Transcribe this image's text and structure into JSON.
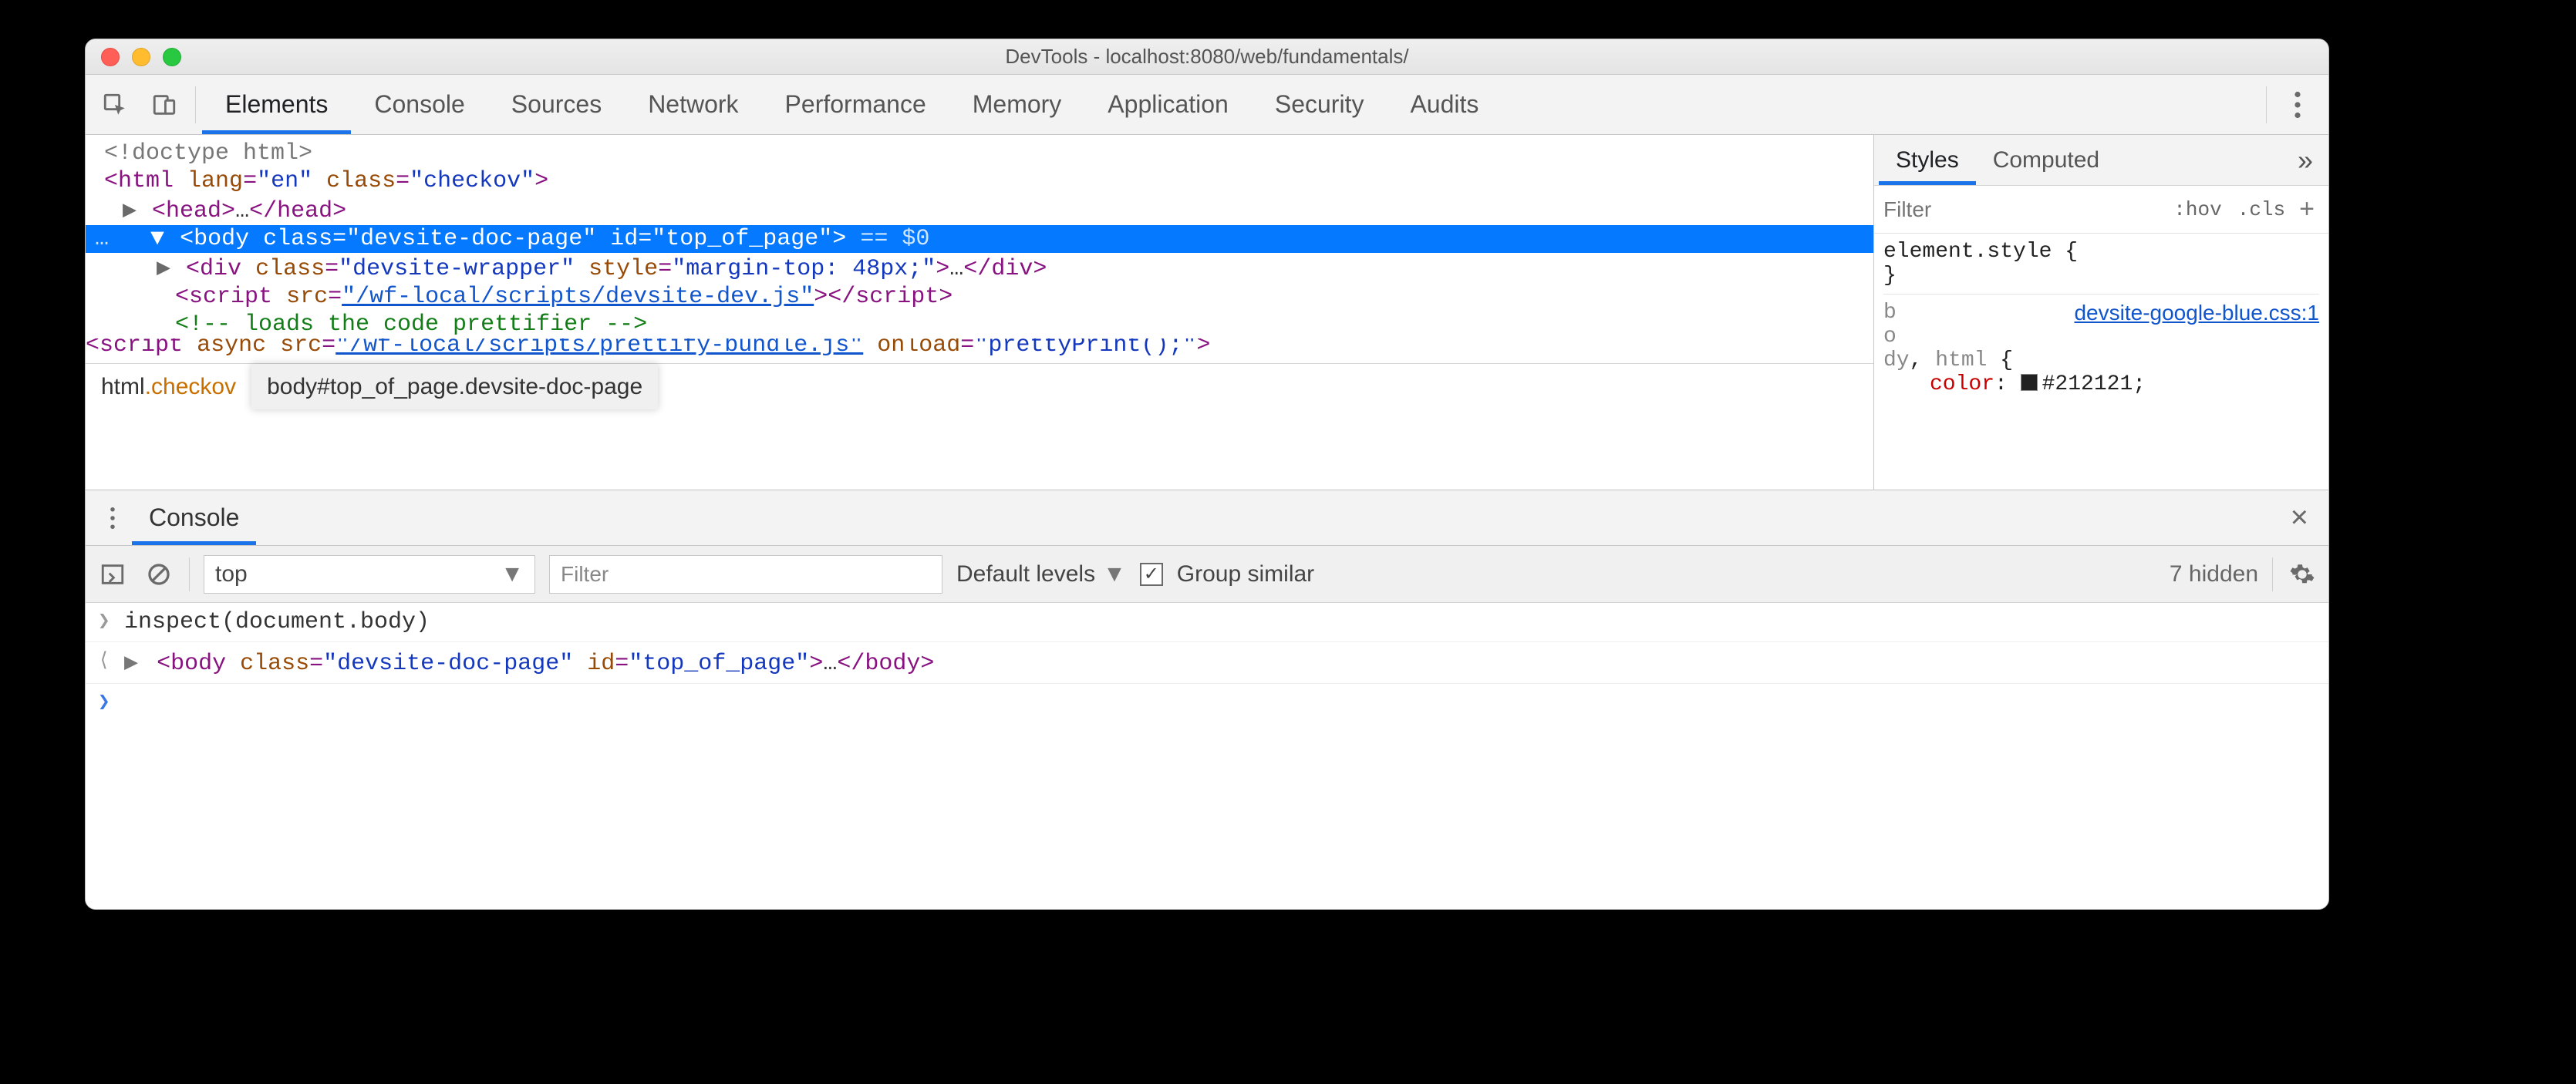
{
  "window": {
    "title": "DevTools - localhost:8080/web/fundamentals/"
  },
  "tabs": {
    "items": [
      "Elements",
      "Console",
      "Sources",
      "Network",
      "Performance",
      "Memory",
      "Application",
      "Security",
      "Audits"
    ],
    "active": "Elements"
  },
  "dom": {
    "l1": "<!doctype html>",
    "l2": {
      "open": "<",
      "tag": "html",
      "a1n": "lang",
      "a1v": "\"en\"",
      "a2n": "class",
      "a2v": "\"checkov\"",
      "close": ">"
    },
    "l3": {
      "tri": "▶",
      "open": "<",
      "tag": "head",
      "close": ">",
      "ell": "…",
      "endopen": "</",
      "endtag": "head",
      "endclose": ">"
    },
    "l4": {
      "pre": "…",
      "tri": "▼",
      "open": "<",
      "tag": "body",
      "a1n": "class",
      "a1v": "\"devsite-doc-page\"",
      "a2n": "id",
      "a2v": "\"top_of_page\"",
      "close": ">",
      "hint": " == $0"
    },
    "l5": {
      "tri": "▶",
      "open": "<",
      "tag": "div",
      "a1n": "class",
      "a1v": "\"devsite-wrapper\"",
      "a2n": "style",
      "a2v": "\"margin-top: 48px;\"",
      "close": ">",
      "ell": "…",
      "endopen": "</",
      "endtag": "div",
      "endclose": ">"
    },
    "l6": {
      "open": "<",
      "tag": "script",
      "a1n": "src",
      "a1v": "\"/wf-local/scripts/devsite-dev.js\"",
      "close": ">",
      "endopen": "</",
      "endtag": "script",
      "endclose": ">"
    },
    "l7": "<!-- loads the code prettifier -->",
    "l8": {
      "text": "<script async src=\"/wf-local/scripts/prettify-bundle.js\" onload=\"prettyPrint();\">"
    }
  },
  "breadcrumb": {
    "item1a": "html",
    "item1b": ".checkov",
    "item2": "body#top_of_page.devsite-doc-page"
  },
  "styles": {
    "tabs": [
      "Styles",
      "Computed"
    ],
    "active": "Styles",
    "more": "»",
    "filter_placeholder": "Filter",
    "hov": ":hov",
    "cls": ".cls",
    "plus": "+",
    "element_style_open": "element.style {",
    "brace_close": "}",
    "rule_src": "devsite-google-blue.css:1",
    "rule_sel_l1": "b",
    "rule_sel_l2": "o",
    "rule_sel_l3a": "dy",
    "rule_sel_l3b": ", ",
    "rule_sel_l3c": "html",
    "rule_sel_l3d": " {",
    "rule_prop": "color",
    "rule_val": "#212121",
    "rule_colon": ": ",
    "rule_semi": ";"
  },
  "drawer": {
    "tab": "Console",
    "context": "top",
    "filter_placeholder": "Filter",
    "levels": "Default levels",
    "group": "Group similar",
    "hidden": "7 hidden",
    "row1": "inspect(document.body)",
    "row2": {
      "tri": "▶",
      "open": "<",
      "tag": "body",
      "a1n": "class",
      "a1v": "\"devsite-doc-page\"",
      "a2n": "id",
      "a2v": "\"top_of_page\"",
      "close": ">",
      "ell": "…",
      "endopen": "</",
      "endtag": "body",
      "endclose": ">"
    }
  }
}
